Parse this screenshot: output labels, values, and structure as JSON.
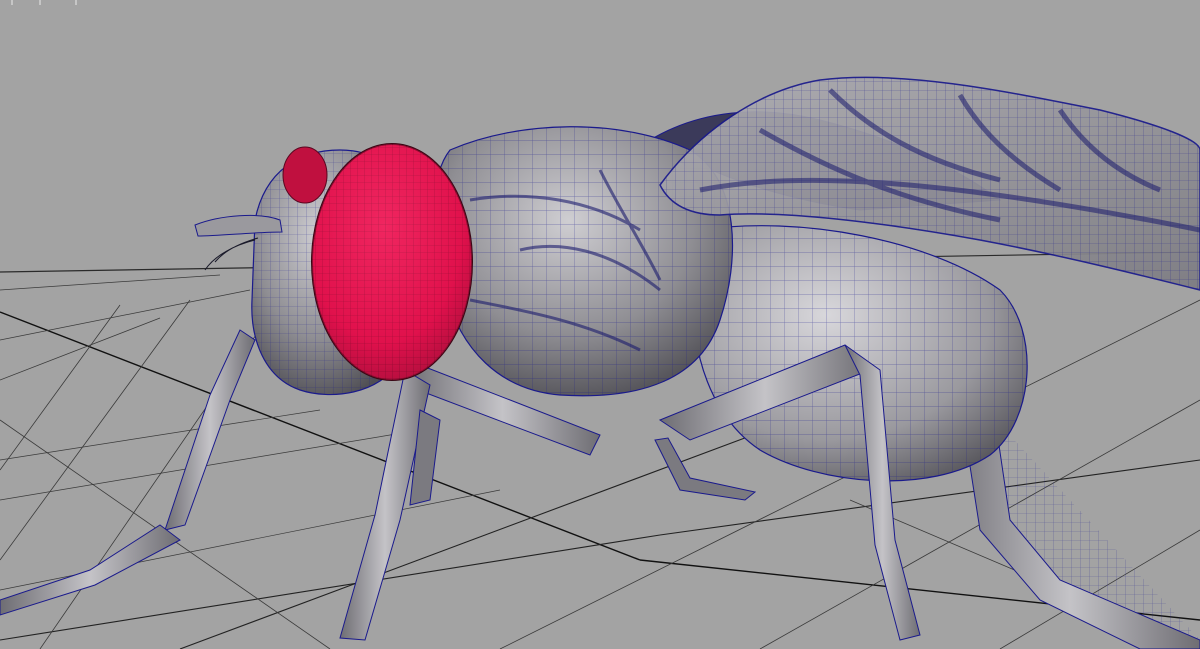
{
  "viewport": {
    "label": "",
    "background": "#a3a3a3",
    "grid_color": "#1a1a1a",
    "mesh_fill": "#8f8e93",
    "mesh_shadow": "#5e5d63",
    "mesh_highlight": "#c9c8cc",
    "wire_color": "#1a1a8c",
    "eye_color": "#e0114c",
    "eye_dark": "#8c0a31"
  },
  "model": {
    "subject": "housefly",
    "display_mode": "wireframe-on-shaded"
  }
}
